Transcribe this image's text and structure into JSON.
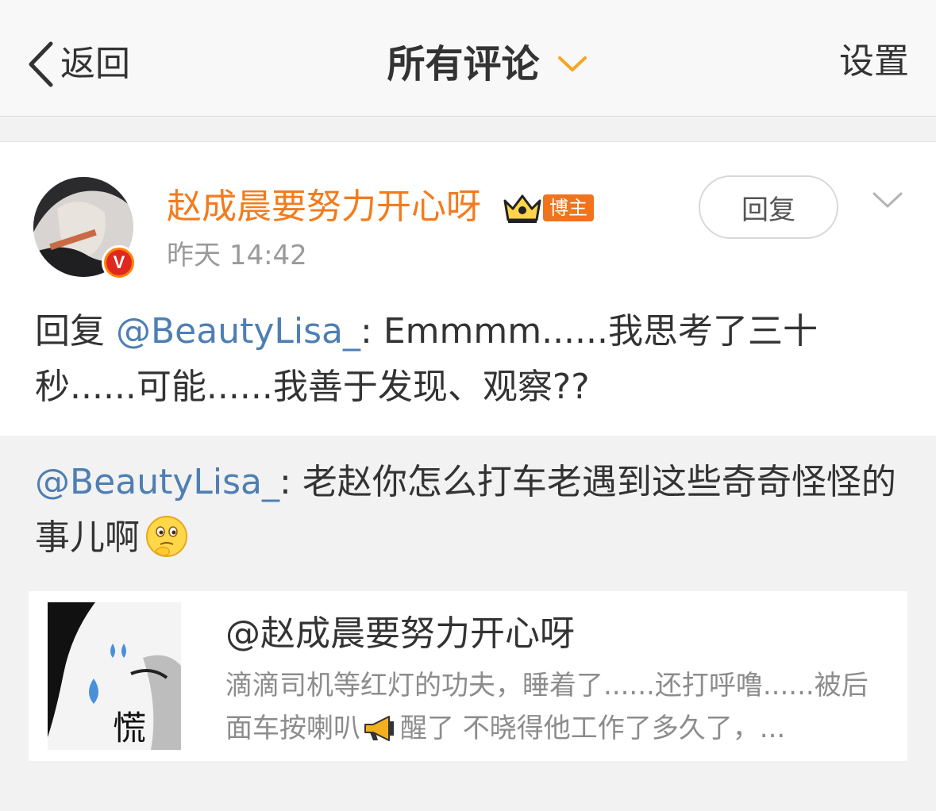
{
  "nav": {
    "back_label": "返回",
    "title": "所有评论",
    "settings_label": "设置"
  },
  "comment": {
    "username": "赵成晨要努力开心呀",
    "badge": "博主",
    "verified_mark": "V",
    "timestamp": "昨天 14:42",
    "reply_button": "回复",
    "text_prefix": "回复 ",
    "text_mention": "@BeautyLisa_",
    "text_body": ": Emmmm......我思考了三十秒......可能......我善于发现、观察??"
  },
  "original": {
    "mention": "@BeautyLisa_",
    "text_body": ": 老赵你怎么打车老遇到这些奇奇怪怪的事儿啊",
    "emoji": "thinking-face"
  },
  "repost": {
    "thumb_text": "慌",
    "username": "@赵成晨要努力开心呀",
    "excerpt_part1": "滴滴司机等红灯的功夫，睡着了......还打呼噜......被后面车按喇叭",
    "excerpt_part2": "醒了       不晓得他工作了多久了，...",
    "icon": "megaphone-icon"
  },
  "colors": {
    "username_orange": "#f37b1d",
    "mention_blue": "#4e7fb2",
    "title_caret": "#f5a623"
  }
}
